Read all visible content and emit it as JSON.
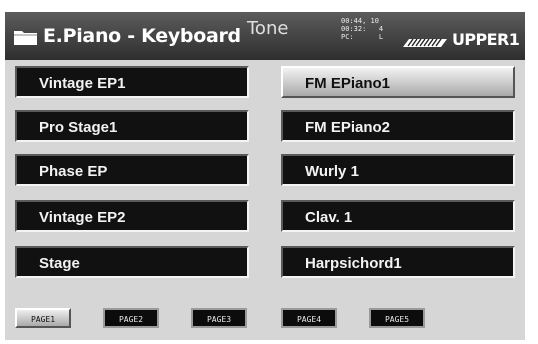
{
  "header": {
    "title": "E.Piano - Keyboard",
    "mode_label": "Tone",
    "info": [
      "00:44, 10",
      "00:32:   4",
      "PC:      L"
    ],
    "part_label": "UPPER1",
    "icons": [
      "folder-icon",
      "keyboard-icon"
    ]
  },
  "tones": {
    "left": [
      "Vintage EP1",
      "Pro Stage1",
      "Phase EP",
      "Vintage EP2",
      "Stage"
    ],
    "right": [
      "FM EPiano1",
      "FM EPiano2",
      "Wurly 1",
      "Clav. 1",
      "Harpsichord1"
    ],
    "selected": "FM EPiano1"
  },
  "pages": {
    "labels": [
      "PAGE1",
      "PAGE2",
      "PAGE3",
      "PAGE4",
      "PAGE5"
    ],
    "selected": "PAGE1"
  },
  "colors": {
    "screen_bg": "#d6d6d6",
    "button_bg": "#111111",
    "selected_bg": "#cfcfcf",
    "header_bg": "#3a3a3a"
  }
}
